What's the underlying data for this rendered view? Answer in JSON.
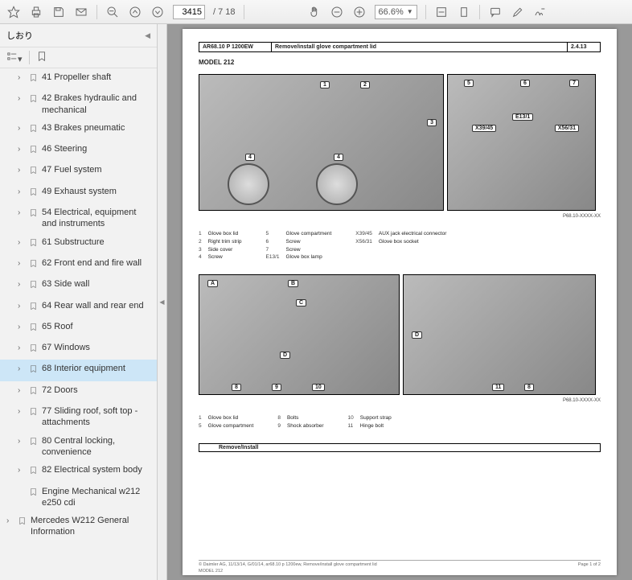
{
  "toolbar": {
    "page_current": "3415",
    "page_sep": "/ 7 18",
    "zoom": "66.6%"
  },
  "sidebar": {
    "title": "しおり",
    "items": [
      {
        "label": "41 Propeller shaft",
        "depth": 1,
        "expandable": true
      },
      {
        "label": "42 Brakes hydraulic and mechanical",
        "depth": 1,
        "expandable": true
      },
      {
        "label": "43 Brakes pneumatic",
        "depth": 1,
        "expandable": true
      },
      {
        "label": "46 Steering",
        "depth": 1,
        "expandable": true
      },
      {
        "label": "47 Fuel system",
        "depth": 1,
        "expandable": true
      },
      {
        "label": "49 Exhaust system",
        "depth": 1,
        "expandable": true
      },
      {
        "label": "54 Electrical, equipment and instruments",
        "depth": 1,
        "expandable": true
      },
      {
        "label": "61 Substructure",
        "depth": 1,
        "expandable": true
      },
      {
        "label": "62 Front end and fire wall",
        "depth": 1,
        "expandable": true
      },
      {
        "label": "63 Side wall",
        "depth": 1,
        "expandable": true
      },
      {
        "label": "64 Rear wall and rear end",
        "depth": 1,
        "expandable": true
      },
      {
        "label": "65 Roof",
        "depth": 1,
        "expandable": true
      },
      {
        "label": "67 Windows",
        "depth": 1,
        "expandable": true
      },
      {
        "label": "68 Interior equipment",
        "depth": 1,
        "expandable": true,
        "selected": true
      },
      {
        "label": "72 Doors",
        "depth": 1,
        "expandable": true
      },
      {
        "label": "77 Sliding roof, soft top - attachments",
        "depth": 1,
        "expandable": true
      },
      {
        "label": "80 Central locking, convenience",
        "depth": 1,
        "expandable": true
      },
      {
        "label": "82 Electrical system body",
        "depth": 1,
        "expandable": true
      },
      {
        "label": "Engine Mechanical w212 e250 cdi",
        "depth": 1,
        "expandable": false
      },
      {
        "label": "Mercedes W212 General Information",
        "depth": 0,
        "expandable": true
      }
    ]
  },
  "doc": {
    "header": {
      "code": "AR68.10 P 1200EW",
      "title": "Remove/install glove compartment lid",
      "date": "2.4.13"
    },
    "model": "MODEL  212",
    "fig1_caption": "P68.10-XXXX-XX",
    "fig2_caption": "P68.10-XXXX-XX",
    "legend1": {
      "c1n": [
        "1",
        "2",
        "3",
        "4"
      ],
      "c1t": [
        "Glove box lid",
        "Right trim strip",
        "Side cover",
        "Screw"
      ],
      "c2n": [
        "5",
        "6",
        "7",
        "E13/1"
      ],
      "c2t": [
        "Glove compartment",
        "Screw",
        "Screw",
        "Glove box lamp"
      ],
      "c3n": [
        "X39/45",
        "X56/31"
      ],
      "c3t": [
        "AUX jack electrical connector",
        "Glove box socket"
      ]
    },
    "legend2": {
      "c1n": [
        "1",
        "5"
      ],
      "c1t": [
        "Glove box lid",
        "Glove compartment"
      ],
      "c2n": [
        "8",
        "9"
      ],
      "c2t": [
        "Bolts",
        "Shock absorber"
      ],
      "c3n": [
        "10",
        "11"
      ],
      "c3t": [
        "Support strap",
        "Hinge bolt"
      ]
    },
    "callouts_top_left": [
      "1",
      "2",
      "3",
      "4"
    ],
    "callouts_top_right": [
      "5",
      "6",
      "7",
      "E13/1",
      "X39/45",
      "X56/31"
    ],
    "callouts_bot_left": [
      "A",
      "B",
      "C",
      "D",
      "8",
      "9",
      "10"
    ],
    "callouts_bot_right": [
      "D",
      "11",
      "8"
    ],
    "section": {
      "num": "",
      "title": "Remove/Install"
    },
    "footer": {
      "left": "© Daimler AG, 11/13/14, G/01/14, ar68.10 p 1200ew, Remove/install glove compartment lid",
      "mid": "MODEL 212",
      "right": "Page 1 of 2"
    }
  }
}
